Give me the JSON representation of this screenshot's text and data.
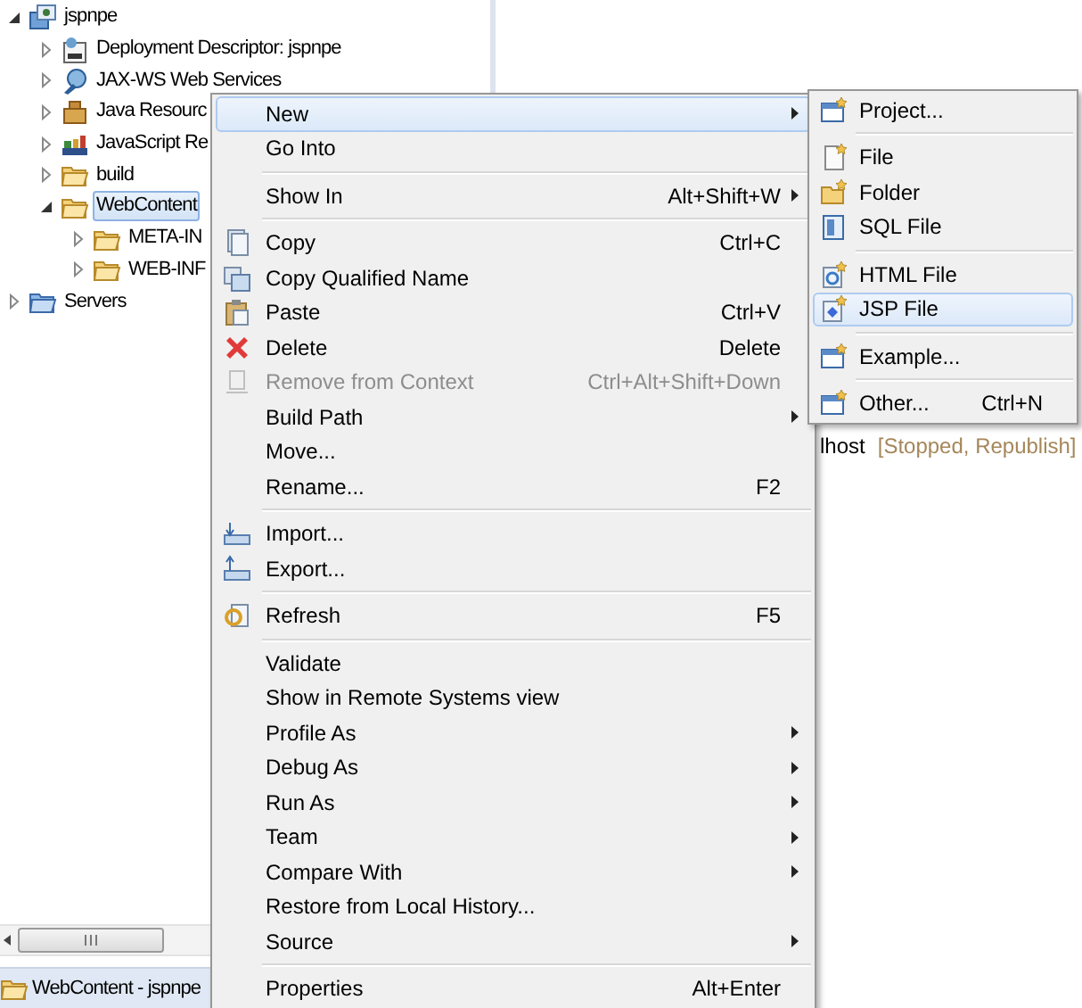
{
  "project_explorer": {
    "tree": [
      {
        "label": "jspnpe",
        "kind": "project",
        "expanded": true,
        "selected": false,
        "children": [
          {
            "label": "Deployment Descriptor: jspnpe",
            "kind": "descriptor",
            "expanded": false,
            "selected": false
          },
          {
            "label": "JAX-WS Web Services",
            "kind": "services",
            "expanded": false,
            "selected": false
          },
          {
            "label": "Java Resourc",
            "kind": "java",
            "expanded": false,
            "selected": false
          },
          {
            "label": "JavaScript Re",
            "kind": "scripts",
            "expanded": false,
            "selected": false
          },
          {
            "label": "build",
            "kind": "folder",
            "expanded": false,
            "selected": false
          },
          {
            "label": "WebContent",
            "kind": "folder",
            "expanded": true,
            "selected": true,
            "children": [
              {
                "label": "META-IN",
                "kind": "folder",
                "expanded": false,
                "selected": false
              },
              {
                "label": "WEB-INF",
                "kind": "folder",
                "expanded": false,
                "selected": false
              }
            ]
          }
        ]
      },
      {
        "label": "Servers",
        "kind": "server-folder",
        "expanded": false,
        "selected": false
      }
    ],
    "status_bar": {
      "text": "WebContent - jspnpe"
    }
  },
  "servers_view": {
    "server": "lhost",
    "state": "[Stopped, Republish]"
  },
  "context_menu": {
    "items": [
      {
        "kind": "item",
        "label": "New",
        "submenu": true,
        "disabled": false,
        "selected": true
      },
      {
        "kind": "item",
        "label": "Go Into",
        "submenu": false,
        "disabled": false,
        "selected": false
      },
      {
        "kind": "separator"
      },
      {
        "kind": "item",
        "label": "Show In",
        "shortcut": "Alt+Shift+W",
        "submenu": true,
        "disabled": false,
        "selected": false
      },
      {
        "kind": "separator"
      },
      {
        "kind": "item",
        "label": "Copy",
        "shortcut": "Ctrl+C",
        "submenu": false,
        "disabled": false,
        "selected": false
      },
      {
        "kind": "item",
        "label": "Copy Qualified Name",
        "submenu": false,
        "disabled": false,
        "selected": false
      },
      {
        "kind": "item",
        "label": "Paste",
        "shortcut": "Ctrl+V",
        "submenu": false,
        "disabled": false,
        "selected": false
      },
      {
        "kind": "item",
        "label": "Delete",
        "shortcut": "Delete",
        "submenu": false,
        "disabled": false,
        "selected": false
      },
      {
        "kind": "item",
        "label": "Remove from Context",
        "shortcut": "Ctrl+Alt+Shift+Down",
        "submenu": false,
        "disabled": true,
        "selected": false
      },
      {
        "kind": "item",
        "label": "Build Path",
        "submenu": true,
        "disabled": false,
        "selected": false
      },
      {
        "kind": "item",
        "label": "Move...",
        "submenu": false,
        "disabled": false,
        "selected": false
      },
      {
        "kind": "item",
        "label": "Rename...",
        "shortcut": "F2",
        "submenu": false,
        "disabled": false,
        "selected": false
      },
      {
        "kind": "separator"
      },
      {
        "kind": "item",
        "label": "Import...",
        "submenu": false,
        "disabled": false,
        "selected": false
      },
      {
        "kind": "item",
        "label": "Export...",
        "submenu": false,
        "disabled": false,
        "selected": false
      },
      {
        "kind": "separator"
      },
      {
        "kind": "item",
        "label": "Refresh",
        "shortcut": "F5",
        "submenu": false,
        "disabled": false,
        "selected": false
      },
      {
        "kind": "separator"
      },
      {
        "kind": "item",
        "label": "Validate",
        "submenu": false,
        "disabled": false,
        "selected": false
      },
      {
        "kind": "item",
        "label": "Show in Remote Systems view",
        "submenu": false,
        "disabled": false,
        "selected": false
      },
      {
        "kind": "item",
        "label": "Profile As",
        "submenu": true,
        "disabled": false,
        "selected": false
      },
      {
        "kind": "item",
        "label": "Debug As",
        "submenu": true,
        "disabled": false,
        "selected": false
      },
      {
        "kind": "item",
        "label": "Run As",
        "submenu": true,
        "disabled": false,
        "selected": false
      },
      {
        "kind": "item",
        "label": "Team",
        "submenu": true,
        "disabled": false,
        "selected": false
      },
      {
        "kind": "item",
        "label": "Compare With",
        "submenu": true,
        "disabled": false,
        "selected": false
      },
      {
        "kind": "item",
        "label": "Restore from Local History...",
        "submenu": false,
        "disabled": false,
        "selected": false
      },
      {
        "kind": "item",
        "label": "Source",
        "submenu": true,
        "disabled": false,
        "selected": false
      },
      {
        "kind": "separator"
      },
      {
        "kind": "item",
        "label": "Properties",
        "shortcut": "Alt+Enter",
        "submenu": false,
        "disabled": false,
        "selected": false
      }
    ],
    "submenu_items": [
      {
        "kind": "item",
        "label": "Project...",
        "submenu": false,
        "disabled": false,
        "selected": false
      },
      {
        "kind": "separator"
      },
      {
        "kind": "item",
        "label": "File",
        "submenu": false,
        "disabled": false,
        "selected": false
      },
      {
        "kind": "item",
        "label": "Folder",
        "submenu": false,
        "disabled": false,
        "selected": false
      },
      {
        "kind": "item",
        "label": "SQL File",
        "submenu": false,
        "disabled": false,
        "selected": false
      },
      {
        "kind": "separator"
      },
      {
        "kind": "item",
        "label": "HTML File",
        "submenu": false,
        "disabled": false,
        "selected": false
      },
      {
        "kind": "item",
        "label": "JSP File",
        "submenu": false,
        "disabled": false,
        "selected": true
      },
      {
        "kind": "separator"
      },
      {
        "kind": "item",
        "label": "Example...",
        "submenu": false,
        "disabled": false,
        "selected": false
      },
      {
        "kind": "separator"
      },
      {
        "kind": "item",
        "label": "Other...",
        "shortcut": "Ctrl+N",
        "submenu": false,
        "disabled": false,
        "selected": false
      }
    ]
  }
}
